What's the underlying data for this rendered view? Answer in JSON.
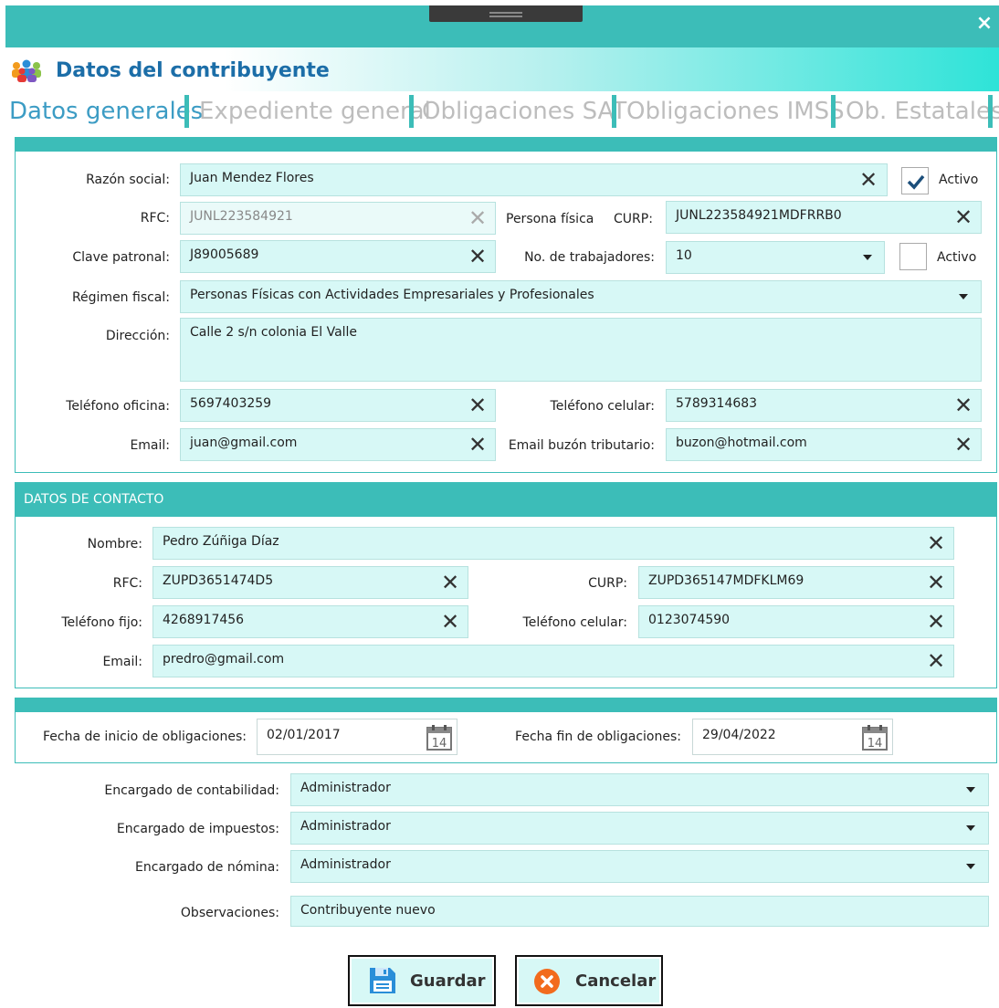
{
  "window": {
    "title": "Datos del contribuyente",
    "close_glyph": "×"
  },
  "tabs": [
    {
      "label": "Datos generales",
      "active": true
    },
    {
      "label": "Expediente general",
      "active": false
    },
    {
      "label": "Obligaciones SAT",
      "active": false
    },
    {
      "label": "Obligaciones IMSS",
      "active": false
    },
    {
      "label": "Ob. Estatales",
      "active": false
    }
  ],
  "general": {
    "razon_social": {
      "label": "Razón social:",
      "value": "Juan Mendez Flores"
    },
    "activo": {
      "label": "Activo",
      "checked": true
    },
    "rfc": {
      "label": "RFC:",
      "value": "JUNL223584921"
    },
    "persona_fisica": {
      "label": "Persona física"
    },
    "curp": {
      "label": "CURP:",
      "value": "JUNL223584921MDFRRB0"
    },
    "clave_patronal": {
      "label": "Clave patronal:",
      "value": "J89005689"
    },
    "no_trabajadores": {
      "label": "No. de trabajadores:",
      "value": "10"
    },
    "activo2": {
      "label": "Activo",
      "checked": false
    },
    "regimen_fiscal": {
      "label": "Régimen fiscal:",
      "value": "Personas Físicas con Actividades Empresariales y Profesionales"
    },
    "direccion": {
      "label": "Dirección:",
      "value": "Calle 2 s/n colonia El Valle"
    },
    "telefono_oficina": {
      "label": "Teléfono oficina:",
      "value": "5697403259"
    },
    "telefono_celular": {
      "label": "Teléfono celular:",
      "value": "5789314683"
    },
    "email": {
      "label": "Email:",
      "value": "juan@gmail.com"
    },
    "email_buzon": {
      "label": "Email buzón tributario:",
      "value": "buzon@hotmail.com"
    }
  },
  "contacto": {
    "section_title": "DATOS DE CONTACTO",
    "nombre": {
      "label": "Nombre:",
      "value": "Pedro Zúñiga Díaz"
    },
    "rfc": {
      "label": "RFC:",
      "value": "ZUPD3651474D5"
    },
    "curp": {
      "label": "CURP:",
      "value": "ZUPD365147MDFKLM69"
    },
    "telefono_fijo": {
      "label": "Teléfono fijo:",
      "value": "4268917456"
    },
    "telefono_celular": {
      "label": "Teléfono celular:",
      "value": "0123074590"
    },
    "email": {
      "label": "Email:",
      "value": "predro@gmail.com"
    }
  },
  "obligaciones": {
    "fecha_inicio": {
      "label": "Fecha de inicio de obligaciones:",
      "value": "02/01/2017"
    },
    "fecha_fin": {
      "label": "Fecha fin de obligaciones:",
      "value": "29/04/2022"
    },
    "calendar_day": "14"
  },
  "encargados": {
    "contabilidad": {
      "label": "Encargado de contabilidad:",
      "value": "Administrador"
    },
    "impuestos": {
      "label": "Encargado de impuestos:",
      "value": "Administrador"
    },
    "nomina": {
      "label": "Encargado de nómina:",
      "value": "Administrador"
    },
    "observaciones": {
      "label": "Observaciones:",
      "value": "Contribuyente nuevo"
    }
  },
  "buttons": {
    "guardar": "Guardar",
    "cancelar": "Cancelar"
  },
  "icons": {
    "clear": "close-x-icon",
    "calendar": "calendar-icon",
    "save": "floppy-disk-icon",
    "cancel": "cancel-circle-icon",
    "people": "people-group-icon"
  },
  "colors": {
    "accent": "#3cbdb8",
    "field_bg": "#d7f8f6",
    "title_blue": "#1c6ea8",
    "tab_active": "#3c9cc4",
    "cancel_orange": "#f26b1d",
    "save_blue": "#2a8ed8"
  }
}
